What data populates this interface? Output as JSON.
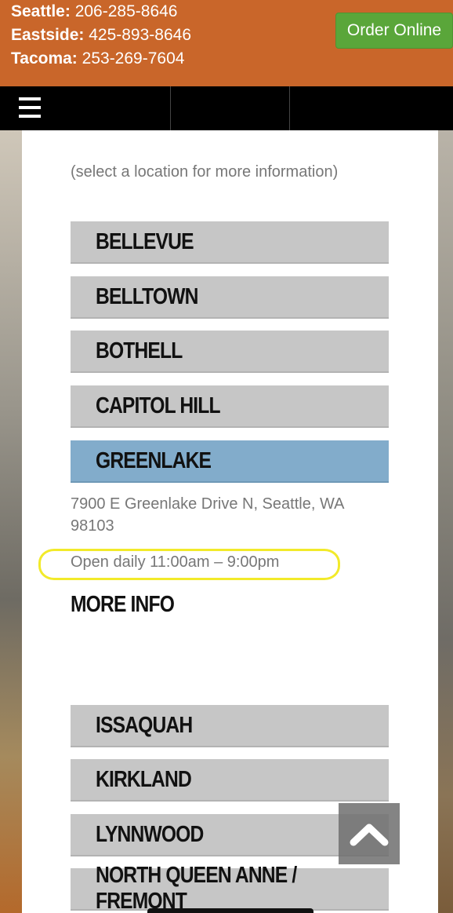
{
  "header": {
    "phones": [
      {
        "city": "Seattle:",
        "number": "206-285-8646"
      },
      {
        "city": "Eastside:",
        "number": "425-893-8646"
      },
      {
        "city": "Tacoma:",
        "number": "253-269-7604"
      }
    ],
    "order_button": "Order Online"
  },
  "nav": {
    "menu_icon": "hamburger-menu-icon"
  },
  "locations_hint": "(select a location for more information)",
  "locations": [
    {
      "name": "BELLEVUE"
    },
    {
      "name": "BELLTOWN"
    },
    {
      "name": "BOTHELL"
    },
    {
      "name": "CAPITOL HILL"
    },
    {
      "name": "GREENLAKE"
    },
    {
      "name": "ISSAQUAH"
    },
    {
      "name": "KIRKLAND"
    },
    {
      "name": "LYNNWOOD"
    },
    {
      "name": "NORTH QUEEN ANNE / FREMONT"
    }
  ],
  "selected": {
    "name": "GREENLAKE",
    "address": "7900 E Greenlake Drive N, Seattle, WA 98103",
    "hours": "Open daily 11:00am – 9:00pm",
    "more_info": "MORE INFO"
  },
  "colors": {
    "header_bg": "#c9662a",
    "order_button": "#5aa63a",
    "location_bg": "#c6c6c6",
    "location_active_bg": "#82accb",
    "highlight_ring": "#f2ea2a"
  },
  "scroll_top_icon": "chevron-up-icon"
}
